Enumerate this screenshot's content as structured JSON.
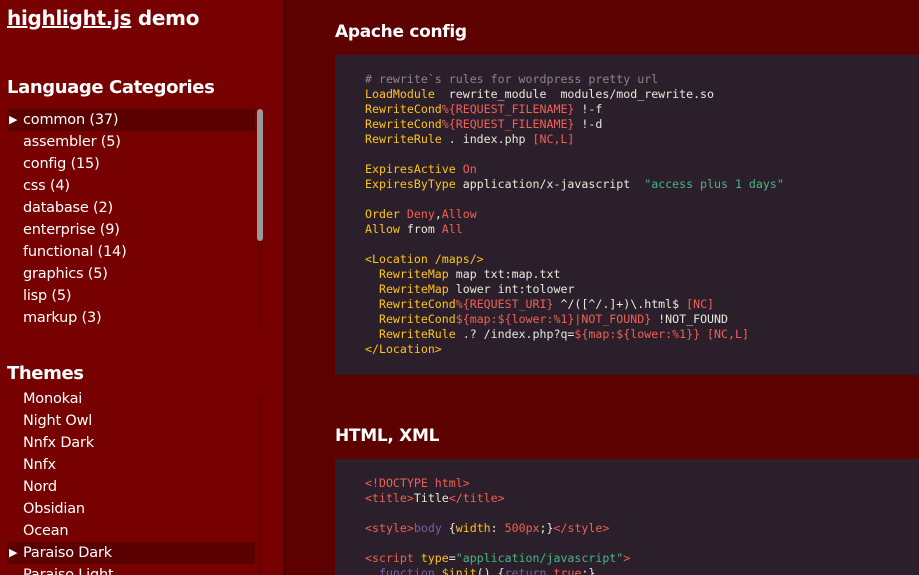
{
  "sidebar": {
    "title_link": "highlight.js",
    "title_rest": " demo",
    "categories_title": "Language Categories",
    "categories": [
      {
        "label": "common (37)",
        "selected": true
      },
      {
        "label": "assembler (5)"
      },
      {
        "label": "config (15)"
      },
      {
        "label": "css (4)"
      },
      {
        "label": "database (2)"
      },
      {
        "label": "enterprise (9)"
      },
      {
        "label": "functional (14)"
      },
      {
        "label": "graphics (5)"
      },
      {
        "label": "lisp (5)"
      },
      {
        "label": "markup (3)"
      }
    ],
    "themes_title": "Themes",
    "themes": [
      {
        "label": "Monokai"
      },
      {
        "label": "Night Owl"
      },
      {
        "label": "Nnfx Dark"
      },
      {
        "label": "Nnfx"
      },
      {
        "label": "Nord"
      },
      {
        "label": "Obsidian"
      },
      {
        "label": "Ocean"
      },
      {
        "label": "Paraiso Dark",
        "selected": true
      },
      {
        "label": "Paraiso Light"
      }
    ],
    "arrow_icon": "triangle-right-icon"
  },
  "main": {
    "apache": {
      "heading": "Apache config",
      "lines": [
        [
          [
            "c-com",
            "# rewrite`s rules for wordpress pretty url"
          ]
        ],
        [
          [
            "c-kw",
            "LoadModule"
          ],
          [
            "",
            "  rewrite_module  modules/mod_rewrite.so"
          ]
        ],
        [
          [
            "c-kw",
            "RewriteCond"
          ],
          [
            "",
            ""
          ],
          [
            "c-var",
            "%{REQUEST_FILENAME}"
          ],
          [
            "",
            " !-f"
          ]
        ],
        [
          [
            "c-kw",
            "RewriteCond"
          ],
          [
            "",
            ""
          ],
          [
            "c-var",
            "%{REQUEST_FILENAME}"
          ],
          [
            "",
            " !-d"
          ]
        ],
        [
          [
            "c-kw",
            "RewriteRule"
          ],
          [
            "",
            " . index.php "
          ],
          [
            "c-var",
            "[NC,L]"
          ]
        ],
        [],
        [
          [
            "c-kw",
            "ExpiresActive"
          ],
          [
            "c-var",
            " On"
          ]
        ],
        [
          [
            "c-kw",
            "ExpiresByType"
          ],
          [
            "",
            " application/x-javascript  "
          ],
          [
            "c-str",
            "\"access plus 1 days\""
          ]
        ],
        [],
        [
          [
            "c-kw",
            "Order"
          ],
          [
            "c-var",
            " Deny"
          ],
          [
            "",
            ","
          ],
          [
            "c-var",
            "Allow"
          ]
        ],
        [
          [
            "c-kw",
            "Allow"
          ],
          [
            "",
            " from "
          ],
          [
            "c-var",
            "All"
          ]
        ],
        [],
        [
          [
            "c-kw",
            "<Location /maps/>"
          ]
        ],
        [
          [
            "",
            "  "
          ],
          [
            "c-kw",
            "RewriteMap"
          ],
          [
            "",
            " map txt:map.txt"
          ]
        ],
        [
          [
            "",
            "  "
          ],
          [
            "c-kw",
            "RewriteMap"
          ],
          [
            "",
            " lower int:tolower"
          ]
        ],
        [
          [
            "",
            "  "
          ],
          [
            "c-kw",
            "RewriteCond"
          ],
          [
            "",
            ""
          ],
          [
            "c-var",
            "%{REQUEST_URI}"
          ],
          [
            "",
            " ^/([^/.]+)\\.html$ "
          ],
          [
            "c-var",
            "[NC]"
          ]
        ],
        [
          [
            "",
            "  "
          ],
          [
            "c-kw",
            "RewriteCond"
          ],
          [
            "",
            ""
          ],
          [
            "c-var",
            "${map:${lower:%1}|NOT_FOUND}"
          ],
          [
            "",
            " !NOT_FOUND"
          ]
        ],
        [
          [
            "",
            "  "
          ],
          [
            "c-kw",
            "RewriteRule"
          ],
          [
            "",
            " .? /index.php?q="
          ],
          [
            "c-var",
            "${map:${lower:%1}}"
          ],
          [
            "",
            " "
          ],
          [
            "c-var",
            "[NC,L]"
          ]
        ],
        [
          [
            "c-kw",
            "</Location>"
          ]
        ]
      ]
    },
    "html": {
      "heading": "HTML, XML",
      "lines": [
        [
          [
            "c-tag",
            "<!DOCTYPE html>"
          ]
        ],
        [
          [
            "c-tag",
            "<title>"
          ],
          [
            "",
            "Title"
          ],
          [
            "c-tag",
            "</title>"
          ]
        ],
        [],
        [
          [
            "c-tag",
            "<style>"
          ],
          [
            "c-func",
            "body"
          ],
          [
            "",
            " {"
          ],
          [
            "c-sel",
            "width"
          ],
          [
            "",
            ": "
          ],
          [
            "c-var",
            "500px"
          ],
          [
            "",
            ";}"
          ],
          [
            "c-tag",
            "</style>"
          ]
        ],
        [],
        [
          [
            "c-tag",
            "<script "
          ],
          [
            "c-attr",
            "type"
          ],
          [
            "",
            "="
          ],
          [
            "c-str",
            "\"application/javascript\""
          ],
          [
            "c-tag",
            ">"
          ]
        ],
        [
          [
            "",
            "  "
          ],
          [
            "c-func",
            "function"
          ],
          [
            "",
            " "
          ],
          [
            "c-kw",
            "$init"
          ],
          [
            "",
            "() {"
          ],
          [
            "c-func",
            "return"
          ],
          [
            "",
            " "
          ],
          [
            "c-var",
            "true"
          ],
          [
            "",
            ";}"
          ]
        ]
      ]
    }
  }
}
